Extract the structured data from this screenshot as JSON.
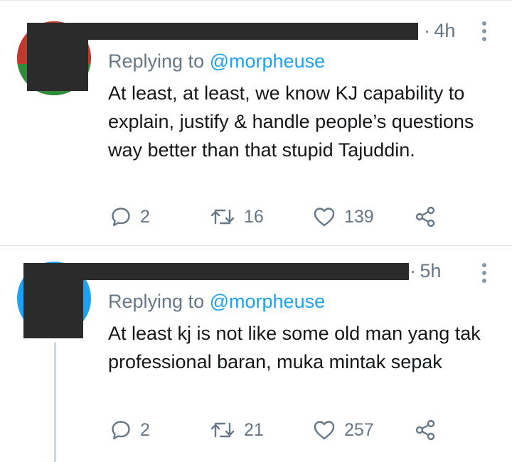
{
  "tweets": [
    {
      "time": "4h",
      "replying_prefix": "Replying to",
      "replying_handle": "@morpheuse",
      "text": "At least, at least, we know KJ capability to explain, justify & handle people’s questions way better than that stupid Tajuddin.",
      "replies": "2",
      "retweets": "16",
      "likes": "139"
    },
    {
      "time": "5h",
      "replying_prefix": "Replying to",
      "replying_handle": "@morpheuse",
      "text": "At least kj is not like some old man yang tak professional baran, muka mintak sepak",
      "replies": "2",
      "retweets": "21",
      "likes": "257"
    }
  ],
  "colors": {
    "link": "#1da1f2",
    "muted": "#657786",
    "text": "#14171a",
    "redaction": "#2b2b2b",
    "divider": "#e1e8ed"
  },
  "icons": [
    "reply-icon",
    "retweet-icon",
    "like-icon",
    "share-icon",
    "more-options-icon"
  ]
}
